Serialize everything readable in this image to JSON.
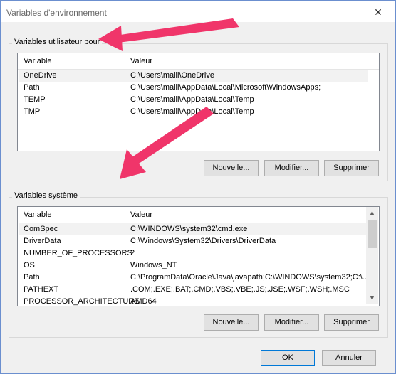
{
  "window": {
    "title": "Variables d'environnement",
    "close_glyph": "✕"
  },
  "user_vars": {
    "group_label": "Variables utilisateur pour",
    "headers": [
      "Variable",
      "Valeur"
    ],
    "rows": [
      {
        "name": "OneDrive",
        "value": "C:\\Users\\maill\\OneDrive"
      },
      {
        "name": "Path",
        "value": "C:\\Users\\maill\\AppData\\Local\\Microsoft\\WindowsApps;"
      },
      {
        "name": "TEMP",
        "value": "C:\\Users\\maill\\AppData\\Local\\Temp"
      },
      {
        "name": "TMP",
        "value": "C:\\Users\\maill\\AppData\\Local\\Temp"
      }
    ],
    "buttons": {
      "new": "Nouvelle...",
      "edit": "Modifier...",
      "delete": "Supprimer"
    }
  },
  "system_vars": {
    "group_label": "Variables système",
    "headers": [
      "Variable",
      "Valeur"
    ],
    "rows": [
      {
        "name": "ComSpec",
        "value": "C:\\WINDOWS\\system32\\cmd.exe"
      },
      {
        "name": "DriverData",
        "value": "C:\\Windows\\System32\\Drivers\\DriverData"
      },
      {
        "name": "NUMBER_OF_PROCESSORS",
        "value": "2"
      },
      {
        "name": "OS",
        "value": "Windows_NT"
      },
      {
        "name": "Path",
        "value": "C:\\ProgramData\\Oracle\\Java\\javapath;C:\\WINDOWS\\system32;C:\\..."
      },
      {
        "name": "PATHEXT",
        "value": ".COM;.EXE;.BAT;.CMD;.VBS;.VBE;.JS;.JSE;.WSF;.WSH;.MSC"
      },
      {
        "name": "PROCESSOR_ARCHITECTURE",
        "value": "AMD64"
      }
    ],
    "buttons": {
      "new": "Nouvelle...",
      "edit": "Modifier...",
      "delete": "Supprimer"
    }
  },
  "footer": {
    "ok": "OK",
    "cancel": "Annuler"
  },
  "colors": {
    "annotation_arrow": "#f0356a",
    "selection": "#f2f2f2",
    "default_button_border": "#0078d7"
  },
  "icons": {
    "scroll_up": "▲",
    "scroll_down": "▼"
  }
}
